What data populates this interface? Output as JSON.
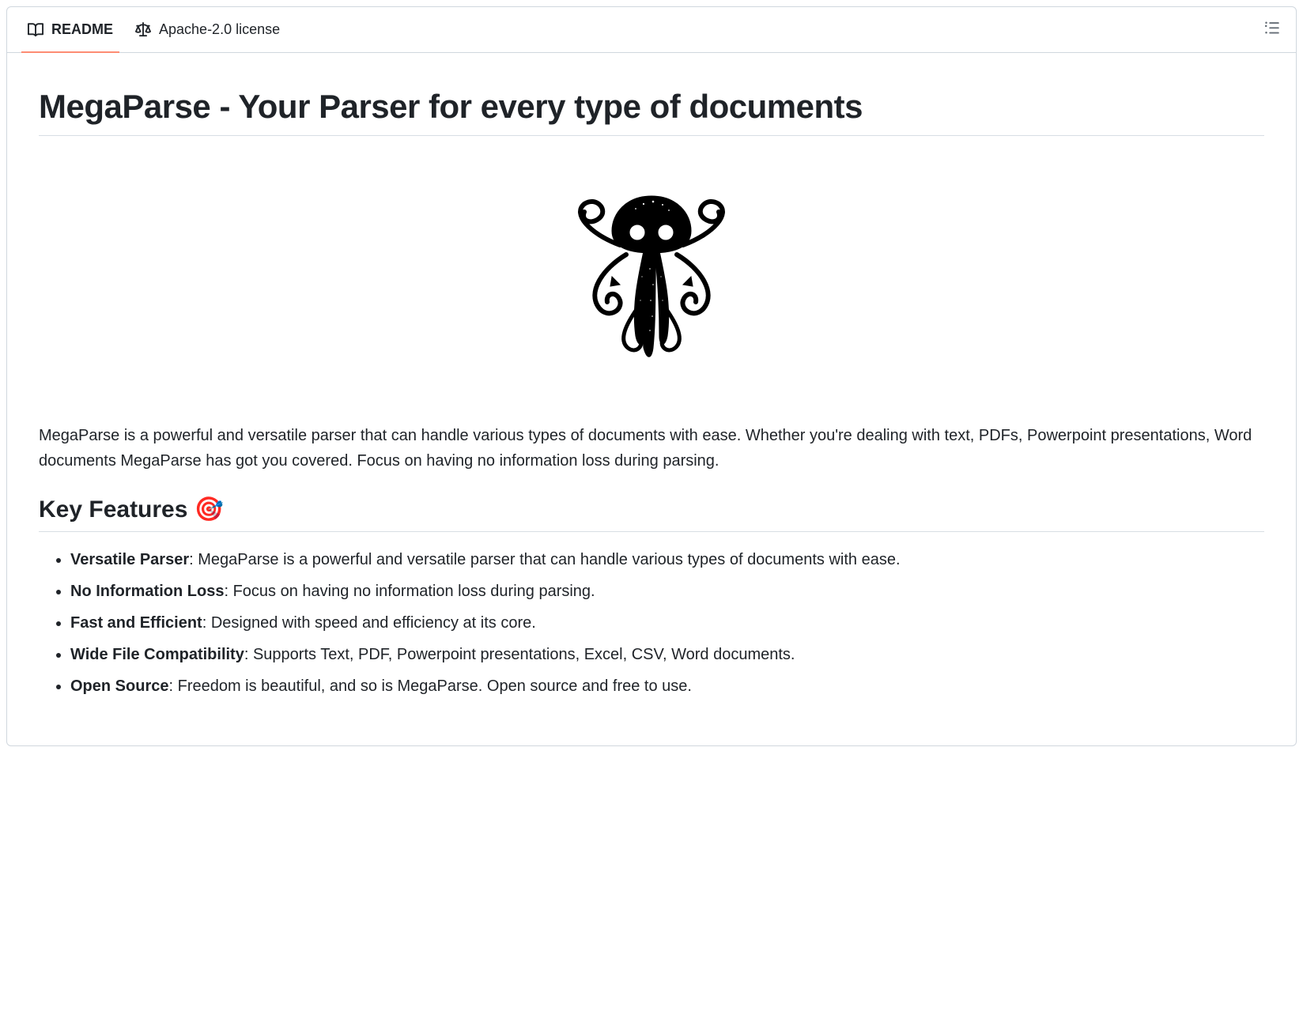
{
  "tabs": {
    "readme_label": "README",
    "license_label": "Apache-2.0 license"
  },
  "main": {
    "title": "MegaParse - Your Parser for every type of documents",
    "intro": "MegaParse is a powerful and versatile parser that can handle various types of documents with ease. Whether you're dealing with text, PDFs, Powerpoint presentations, Word documents MegaParse has got you covered. Focus on having no information loss during parsing.",
    "section_title": "Key Features 🎯",
    "features": [
      {
        "bold": "Versatile Parser",
        "rest": ": MegaParse is a powerful and versatile parser that can handle various types of documents with ease."
      },
      {
        "bold": "No Information Loss",
        "rest": ": Focus on having no information loss during parsing."
      },
      {
        "bold": "Fast and Efficient",
        "rest": ": Designed with speed and efficiency at its core."
      },
      {
        "bold": "Wide File Compatibility",
        "rest": ": Supports Text, PDF, Powerpoint presentations, Excel, CSV, Word documents."
      },
      {
        "bold": "Open Source",
        "rest": ": Freedom is beautiful, and so is MegaParse. Open source and free to use."
      }
    ]
  }
}
